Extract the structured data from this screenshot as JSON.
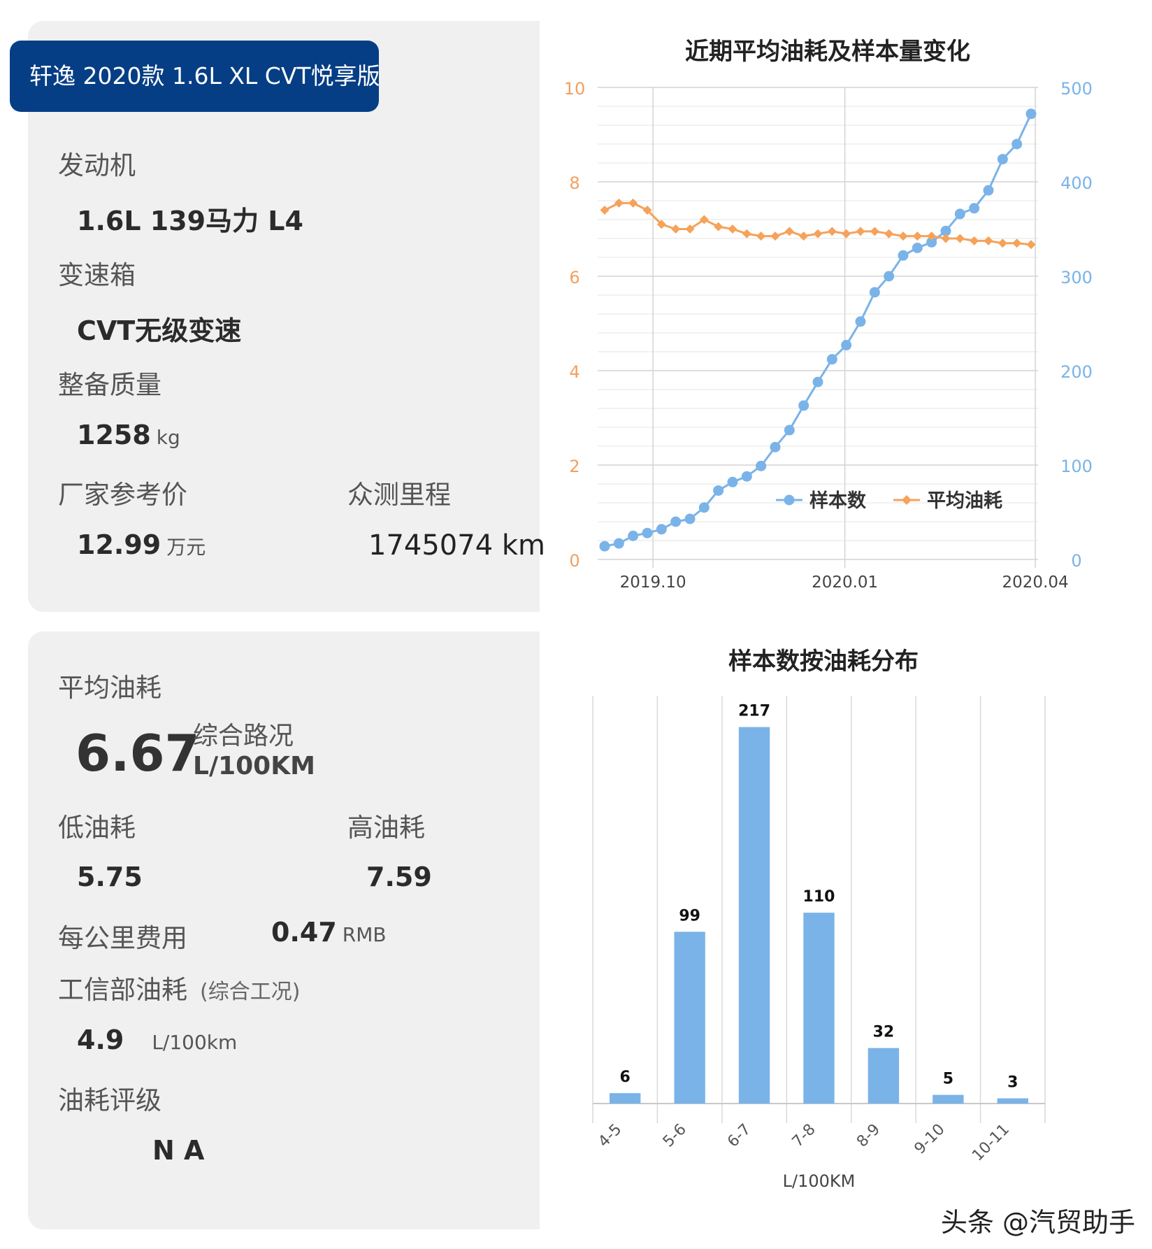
{
  "model": "轩逸 2020款 1.6L XL CVT悦享版",
  "specs": {
    "engine_label": "发动机",
    "engine_value": "1.6L 139马力 L4",
    "gearbox_label": "变速箱",
    "gearbox_value": "CVT无级变速",
    "weight_label": "整备质量",
    "weight_value": "1258",
    "weight_unit": "kg",
    "price_label": "厂家参考价",
    "price_value": "12.99",
    "price_unit": "万元",
    "mileage_label": "众测里程",
    "mileage_value": "1745074 km"
  },
  "consumption": {
    "avg_label": "平均油耗",
    "avg_value": "6.67",
    "avg_condition": "综合路况",
    "avg_unit": "L/100KM",
    "low_label": "低油耗",
    "low_value": "5.75",
    "high_label": "高油耗",
    "high_value": "7.59",
    "cost_label": "每公里费用",
    "cost_value": "0.47",
    "cost_unit": "RMB",
    "miit_label": "工信部油耗",
    "miit_note": "(综合工况)",
    "miit_value": "4.9",
    "miit_unit": "L/100km",
    "rating_label": "油耗评级",
    "rating_value": "N A"
  },
  "colors": {
    "blue": "#7ab3e8",
    "orange": "#f5a25a",
    "pill": "#063e85"
  },
  "watermark": "头条 @汽贸助手",
  "chart_data": [
    {
      "type": "line",
      "title": "近期平均油耗及样本量变化",
      "x_tick_labels": [
        "2019.10",
        "2020.01",
        "2020.04"
      ],
      "y_left_ticks": [
        "0",
        "2",
        "4",
        "6",
        "8",
        "10"
      ],
      "y_right_ticks": [
        "0",
        "100",
        "200",
        "300",
        "400",
        "500"
      ],
      "ylim_left": [
        0,
        10
      ],
      "ylim_right": [
        0,
        500
      ],
      "legend_position": "lower-right",
      "series": [
        {
          "name": "样本数",
          "axis": "right",
          "color": "#7ab3e8",
          "values": [
            14,
            17,
            25,
            28,
            32,
            40,
            43,
            55,
            73,
            82,
            88,
            99,
            119,
            137,
            163,
            188,
            212,
            227,
            252,
            283,
            300,
            322,
            330,
            336,
            348,
            366,
            372,
            391,
            424,
            440,
            472
          ]
        },
        {
          "name": "平均油耗",
          "axis": "left",
          "color": "#f5a25a",
          "values": [
            7.4,
            7.55,
            7.55,
            7.4,
            7.1,
            7.0,
            7.0,
            7.2,
            7.05,
            7.0,
            6.9,
            6.85,
            6.85,
            6.95,
            6.85,
            6.9,
            6.95,
            6.9,
            6.95,
            6.95,
            6.9,
            6.85,
            6.85,
            6.85,
            6.8,
            6.8,
            6.75,
            6.75,
            6.7,
            6.7,
            6.67
          ]
        }
      ]
    },
    {
      "type": "bar",
      "title": "样本数按油耗分布",
      "categories": [
        "4-5",
        "5-6",
        "6-7",
        "7-8",
        "8-9",
        "9-10",
        "10-11"
      ],
      "values": [
        6,
        99,
        217,
        110,
        32,
        5,
        3
      ],
      "xlabel": "L/100KM",
      "color": "#7ab3e8"
    }
  ]
}
